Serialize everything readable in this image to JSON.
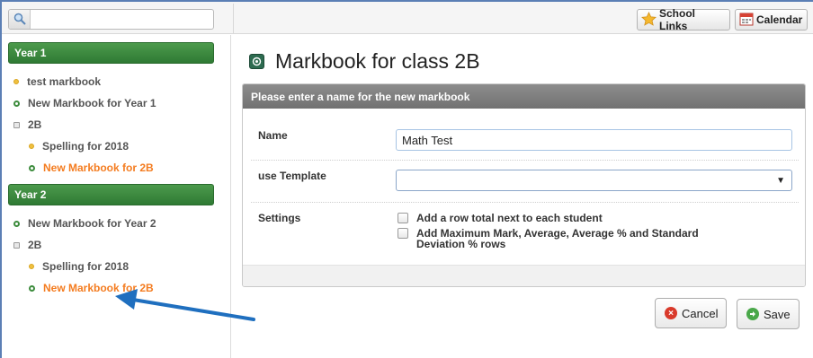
{
  "search": {
    "placeholder": ""
  },
  "toolbar": {
    "school_links_label": "School Links",
    "calendar_label": "Calendar"
  },
  "sidebar": {
    "groups": [
      {
        "header": "Year 1",
        "items": [
          {
            "label": "test markbook",
            "bullet": "yellow"
          },
          {
            "label": "New Markbook for Year 1",
            "bullet": "green"
          },
          {
            "label": "2B",
            "bullet": "square"
          },
          {
            "label": "Spelling for 2018",
            "bullet": "yellow"
          },
          {
            "label": "New Markbook for 2B",
            "bullet": "green",
            "active": true
          }
        ]
      },
      {
        "header": "Year 2",
        "items": [
          {
            "label": "New Markbook for Year 2",
            "bullet": "green"
          },
          {
            "label": "2B",
            "bullet": "square"
          },
          {
            "label": "Spelling for 2018",
            "bullet": "yellow"
          },
          {
            "label": "New Markbook for 2B",
            "bullet": "green",
            "active": true
          }
        ]
      }
    ]
  },
  "main": {
    "title": "Markbook for class 2B",
    "panel_header": "Please enter a name for the new markbook",
    "form": {
      "name_label": "Name",
      "name_value": "Math Test",
      "template_label": "use Template",
      "template_value": "",
      "settings_label": "Settings",
      "option_row_total": "Add a row total next to each student",
      "option_max_mark_line1": "Add Maximum Mark, Average, Average % and Standard",
      "option_max_mark_line2": "Deviation % rows"
    },
    "cancel_label": "Cancel",
    "save_label": "Save"
  },
  "colors": {
    "group_header": "#2f7a34",
    "active_item": "#f47c20",
    "panel_header": "#7f7f7f",
    "annotation_arrow": "#1f6fbf"
  }
}
